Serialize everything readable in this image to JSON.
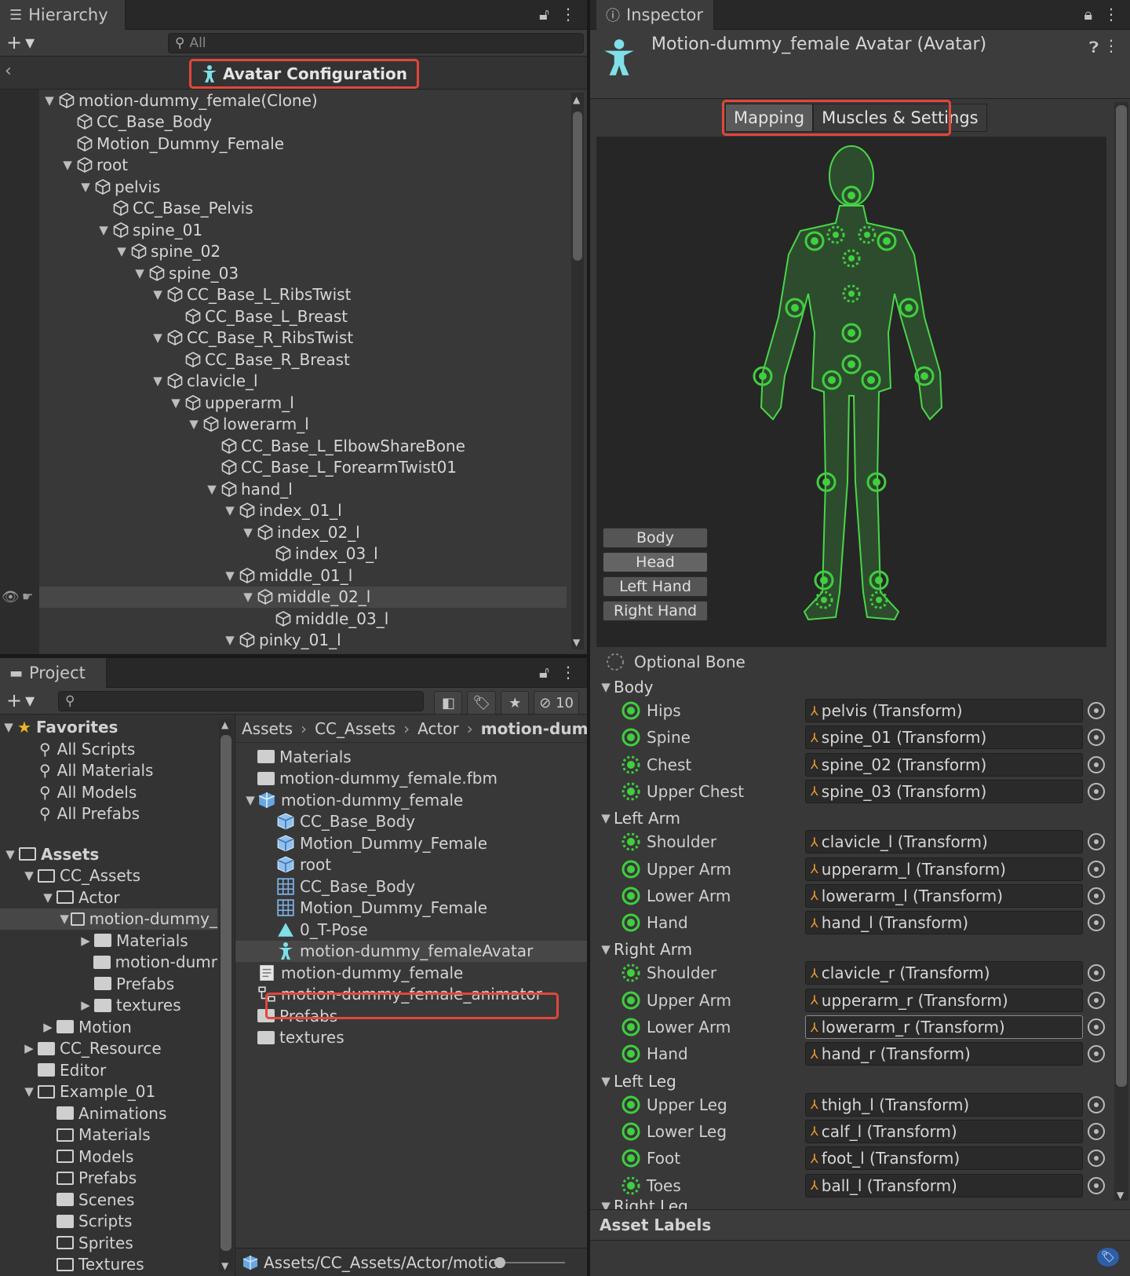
{
  "hierarchy": {
    "tab_label": "Hierarchy",
    "search_placeholder": "All",
    "avatar_configuration": "Avatar Configuration",
    "items": [
      {
        "label": "motion-dummy_female(Clone)",
        "depth": 1,
        "expanded": true
      },
      {
        "label": "CC_Base_Body",
        "depth": 2
      },
      {
        "label": "Motion_Dummy_Female",
        "depth": 2
      },
      {
        "label": "root",
        "depth": 2,
        "expanded": true
      },
      {
        "label": "pelvis",
        "depth": 3,
        "expanded": true
      },
      {
        "label": "CC_Base_Pelvis",
        "depth": 4
      },
      {
        "label": "spine_01",
        "depth": 4,
        "expanded": true
      },
      {
        "label": "spine_02",
        "depth": 5,
        "expanded": true
      },
      {
        "label": "spine_03",
        "depth": 6,
        "expanded": true
      },
      {
        "label": "CC_Base_L_RibsTwist",
        "depth": 7,
        "expanded": true
      },
      {
        "label": "CC_Base_L_Breast",
        "depth": 8
      },
      {
        "label": "CC_Base_R_RibsTwist",
        "depth": 7,
        "expanded": true
      },
      {
        "label": "CC_Base_R_Breast",
        "depth": 8
      },
      {
        "label": "clavicle_l",
        "depth": 7,
        "expanded": true
      },
      {
        "label": "upperarm_l",
        "depth": 8,
        "expanded": true
      },
      {
        "label": "lowerarm_l",
        "depth": 9,
        "expanded": true
      },
      {
        "label": "CC_Base_L_ElbowShareBone",
        "depth": 10
      },
      {
        "label": "CC_Base_L_ForearmTwist01",
        "depth": 10
      },
      {
        "label": "hand_l",
        "depth": 10,
        "expanded": true
      },
      {
        "label": "index_01_l",
        "depth": 11,
        "expanded": true
      },
      {
        "label": "index_02_l",
        "depth": 12,
        "expanded": true
      },
      {
        "label": "index_03_l",
        "depth": 13
      },
      {
        "label": "middle_01_l",
        "depth": 11,
        "expanded": true
      },
      {
        "label": "middle_02_l",
        "depth": 12,
        "expanded": true,
        "selected": true
      },
      {
        "label": "middle_03_l",
        "depth": 13
      },
      {
        "label": "pinky_01_l",
        "depth": 11,
        "expanded": true
      }
    ]
  },
  "project": {
    "tab_label": "Project",
    "hidden_count": "10",
    "favorites": {
      "label": "Favorites",
      "items": [
        "All Scripts",
        "All Materials",
        "All Models",
        "All Prefabs"
      ]
    },
    "assets_tree": [
      {
        "label": "Assets",
        "depth": 0,
        "bold": true,
        "arrow": "open"
      },
      {
        "label": "CC_Assets",
        "depth": 1,
        "arrow": "open"
      },
      {
        "label": "Actor",
        "depth": 2,
        "arrow": "open"
      },
      {
        "label": "motion-dummy_",
        "depth": 3,
        "arrow": "open",
        "selected": true
      },
      {
        "label": "Materials",
        "depth": 4,
        "arrow": "closed"
      },
      {
        "label": "motion-dumr",
        "depth": 4,
        "arrow": "none"
      },
      {
        "label": "Prefabs",
        "depth": 4,
        "arrow": "none"
      },
      {
        "label": "textures",
        "depth": 4,
        "arrow": "closed"
      },
      {
        "label": "Motion",
        "depth": 2,
        "arrow": "closed"
      },
      {
        "label": "CC_Resource",
        "depth": 1,
        "arrow": "closed"
      },
      {
        "label": "Editor",
        "depth": 1,
        "arrow": "none"
      },
      {
        "label": "Example_01",
        "depth": 1,
        "arrow": "open"
      },
      {
        "label": "Animations",
        "depth": 2,
        "arrow": "none"
      },
      {
        "label": "Materials",
        "depth": 2,
        "arrow": "none",
        "empty": true
      },
      {
        "label": "Models",
        "depth": 2,
        "arrow": "none",
        "empty": true
      },
      {
        "label": "Prefabs",
        "depth": 2,
        "arrow": "none",
        "empty": true
      },
      {
        "label": "Scenes",
        "depth": 2,
        "arrow": "none"
      },
      {
        "label": "Scripts",
        "depth": 2,
        "arrow": "none"
      },
      {
        "label": "Sprites",
        "depth": 2,
        "arrow": "none",
        "empty": true
      },
      {
        "label": "Textures",
        "depth": 2,
        "arrow": "none",
        "empty": true
      }
    ],
    "breadcrumb": [
      "Assets",
      "CC_Assets",
      "Actor",
      "motion-dumm"
    ],
    "files": [
      {
        "label": "Materials",
        "depth": 0,
        "icon": "folder-icon"
      },
      {
        "label": "motion-dummy_female.fbm",
        "depth": 0,
        "icon": "folder-icon"
      },
      {
        "label": "motion-dummy_female",
        "depth": 0,
        "icon": "model-icon",
        "expanded": true
      },
      {
        "label": "CC_Base_Body",
        "depth": 1,
        "icon": "mesh-object-icon"
      },
      {
        "label": "Motion_Dummy_Female",
        "depth": 1,
        "icon": "mesh-object-icon"
      },
      {
        "label": "root",
        "depth": 1,
        "icon": "mesh-object-icon"
      },
      {
        "label": "CC_Base_Body",
        "depth": 1,
        "icon": "mesh-grid-icon"
      },
      {
        "label": "Motion_Dummy_Female",
        "depth": 1,
        "icon": "mesh-grid-icon"
      },
      {
        "label": "0_T-Pose",
        "depth": 1,
        "icon": "animation-clip-icon"
      },
      {
        "label": "motion-dummy_femaleAvatar",
        "depth": 1,
        "icon": "avatar-icon",
        "selected": true
      },
      {
        "label": "motion-dummy_female",
        "depth": 0,
        "icon": "document-icon"
      },
      {
        "label": "motion-dummy_female_animator",
        "depth": 0,
        "icon": "animator-icon"
      },
      {
        "label": "Prefabs",
        "depth": 0,
        "icon": "folder-icon"
      },
      {
        "label": "textures",
        "depth": 0,
        "icon": "folder-icon"
      }
    ],
    "footer_path": "Assets/CC_Assets/Actor/motic"
  },
  "inspector": {
    "tab_label": "Inspector",
    "title": "Motion-dummy_female Avatar (Avatar)",
    "tabs": [
      "Mapping",
      "Muscles & Settings"
    ],
    "active_tab": "Mapping",
    "body_parts": [
      "Body",
      "Head",
      "Left Hand",
      "Right Hand"
    ],
    "optional_bone_label": "Optional Bone",
    "sections": [
      {
        "name": "Body",
        "bones": [
          {
            "label": "Hips",
            "value": "pelvis (Transform)",
            "optional": false
          },
          {
            "label": "Spine",
            "value": "spine_01 (Transform)",
            "optional": false
          },
          {
            "label": "Chest",
            "value": "spine_02 (Transform)",
            "optional": true
          },
          {
            "label": "Upper Chest",
            "value": "spine_03 (Transform)",
            "optional": true
          }
        ]
      },
      {
        "name": "Left Arm",
        "bones": [
          {
            "label": "Shoulder",
            "value": "clavicle_l (Transform)",
            "optional": true
          },
          {
            "label": "Upper Arm",
            "value": "upperarm_l (Transform)",
            "optional": false
          },
          {
            "label": "Lower Arm",
            "value": "lowerarm_l (Transform)",
            "optional": false
          },
          {
            "label": "Hand",
            "value": "hand_l (Transform)",
            "optional": false
          }
        ]
      },
      {
        "name": "Right Arm",
        "bones": [
          {
            "label": "Shoulder",
            "value": "clavicle_r (Transform)",
            "optional": true
          },
          {
            "label": "Upper Arm",
            "value": "upperarm_r (Transform)",
            "optional": false
          },
          {
            "label": "Lower Arm",
            "value": "lowerarm_r (Transform)",
            "optional": false,
            "highlighted": true
          },
          {
            "label": "Hand",
            "value": "hand_r (Transform)",
            "optional": false
          }
        ]
      },
      {
        "name": "Left Leg",
        "bones": [
          {
            "label": "Upper Leg",
            "value": "thigh_l (Transform)",
            "optional": false
          },
          {
            "label": "Lower Leg",
            "value": "calf_l (Transform)",
            "optional": false
          },
          {
            "label": "Foot",
            "value": "foot_l (Transform)",
            "optional": false
          },
          {
            "label": "Toes",
            "value": "ball_l (Transform)",
            "optional": true
          }
        ]
      }
    ],
    "next_section_partial": "Right Leg",
    "asset_labels": "Asset Labels"
  },
  "colors": {
    "accent_red": "#e2473a",
    "bone_green": "#3fcf3f",
    "figure_line": "#49d649"
  }
}
